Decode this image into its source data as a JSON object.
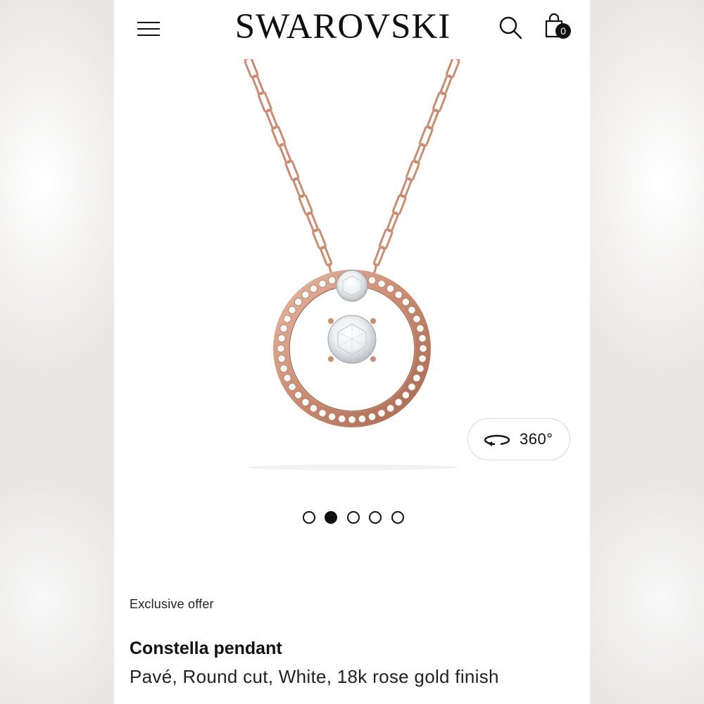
{
  "header": {
    "brand": "SWAROVSKI",
    "menu_icon": "hamburger-menu-icon",
    "search_icon": "search-icon",
    "bag_icon": "shopping-bag-icon",
    "bag_count": "0"
  },
  "gallery": {
    "image_subject": "rose gold pendant necklace with pavé circle and round white crystal",
    "view_360_label": "360°",
    "view_360_icon": "rotate-360-icon",
    "dot_count": 5,
    "active_dot": 2
  },
  "product": {
    "offer_label": "Exclusive offer",
    "name": "Constella pendant",
    "description": "Pavé, Round cut, White, 18k rose gold finish"
  },
  "colors": {
    "rose_gold": "#d19a83",
    "rose_gold_dark": "#9a6048",
    "text": "#111111",
    "background": "#ffffff"
  }
}
